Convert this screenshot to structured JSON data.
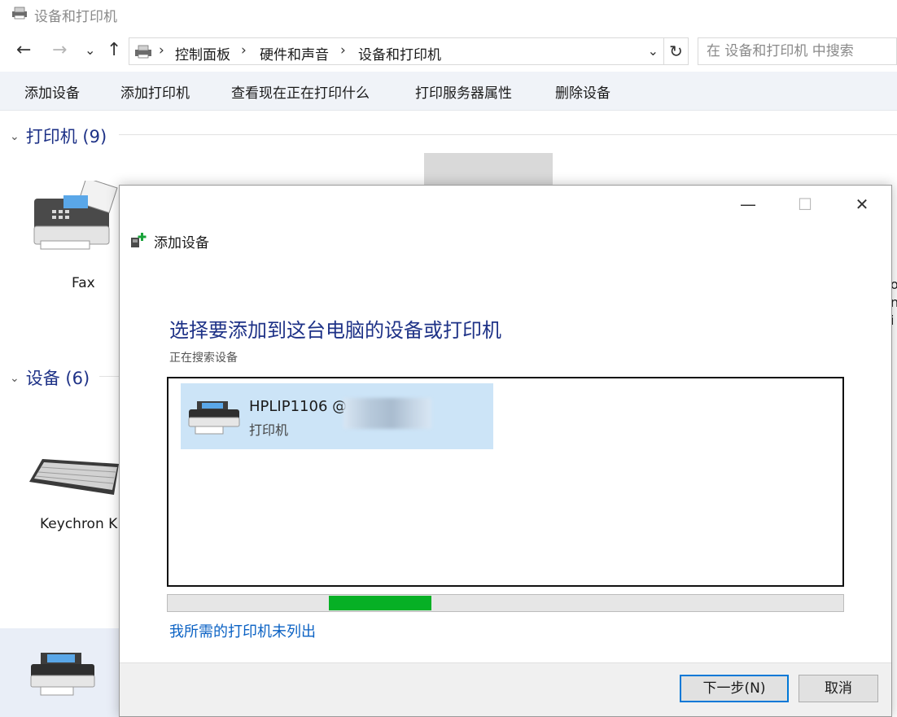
{
  "window": {
    "title": "设备和打印机"
  },
  "nav": {
    "back": "←",
    "forward": "→",
    "recent": "⌄",
    "up": "↑",
    "refresh": "↻",
    "dropdown": "⌄"
  },
  "breadcrumb": {
    "separator": "›",
    "items": [
      "控制面板",
      "硬件和声音",
      "设备和打印机"
    ]
  },
  "search": {
    "placeholder": "在 设备和打印机 中搜索"
  },
  "commands": [
    "添加设备",
    "添加打印机",
    "查看现在正在打印什么",
    "打印服务器属性",
    "删除设备"
  ],
  "groups": {
    "printers": {
      "label": "打印机 (9)",
      "chevron": "⌄"
    },
    "devices": {
      "label": "设备 (6)",
      "chevron": "⌄"
    }
  },
  "background_devices": {
    "fax": "Fax",
    "keyboard": "Keychron K",
    "right_clip": [
      "o",
      "n",
      "i"
    ]
  },
  "dialog": {
    "title": "添加设备",
    "controls": {
      "minimize": "—",
      "maximize": "☐",
      "close": "✕"
    },
    "heading": "选择要添加到这台电脑的设备或打印机",
    "status": "正在搜索设备",
    "device": {
      "name": "HPLIP1106 @",
      "type": "打印机"
    },
    "progress": {
      "fill_start": 0.238,
      "fill_end": 0.39
    },
    "link": "我所需的打印机未列出",
    "buttons": {
      "next": "下一步(N)",
      "cancel": "取消"
    }
  },
  "colors": {
    "heading_blue": "#1e3287",
    "link_blue": "#0b62c4",
    "selection": "#cce4f7",
    "progress_green": "#06b025",
    "command_bar": "#f0f3f8",
    "button_accent": "#0078d7"
  },
  "icons": [
    "printer-folder-icon",
    "computer-devices-icon",
    "fax-printer-icon",
    "keyboard-icon",
    "printer-icon",
    "add-device-icon"
  ]
}
